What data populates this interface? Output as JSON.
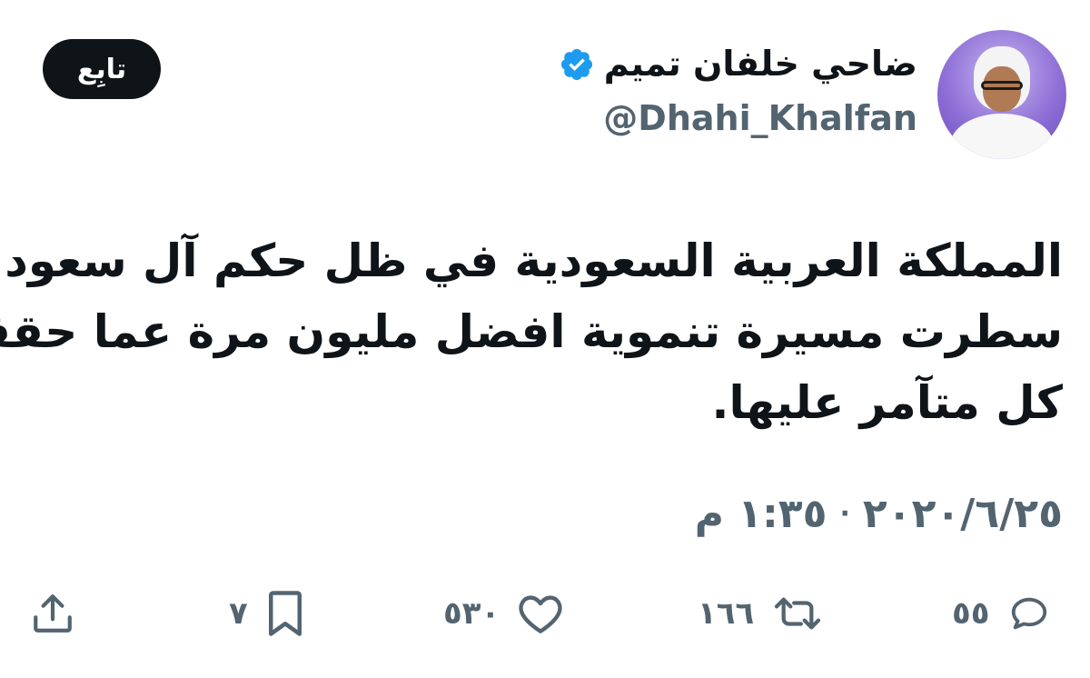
{
  "author": {
    "display_name": "ضاحي خلفان تميم",
    "handle": "@Dhahi_Khalfan",
    "verified": true
  },
  "follow_button": {
    "label": "تابِع"
  },
  "tweet": {
    "lines": [
      "المملكة العربية السعودية في ظل حكم آل سعود",
      "سطرت مسيرة تنموية افضل مليون مرة عما حققه",
      "كل متآمر عليها."
    ]
  },
  "timestamp": {
    "time": "١:٣٥ م",
    "separator": "·",
    "date": "٢٠٢٠/٦/٢٥"
  },
  "actions": {
    "replies": "٥٥",
    "retweets": "١٦٦",
    "likes": "٥٣٠",
    "bookmarks": "٧"
  },
  "icons": {
    "verified": "verified-badge-icon",
    "reply": "reply-icon",
    "retweet": "retweet-icon",
    "like": "heart-icon",
    "bookmark": "bookmark-icon",
    "share": "share-icon"
  },
  "colors": {
    "verified_blue": "#1d9bf0",
    "text_primary": "#0f1419",
    "text_secondary": "#536471",
    "follow_bg": "#0f1419"
  }
}
